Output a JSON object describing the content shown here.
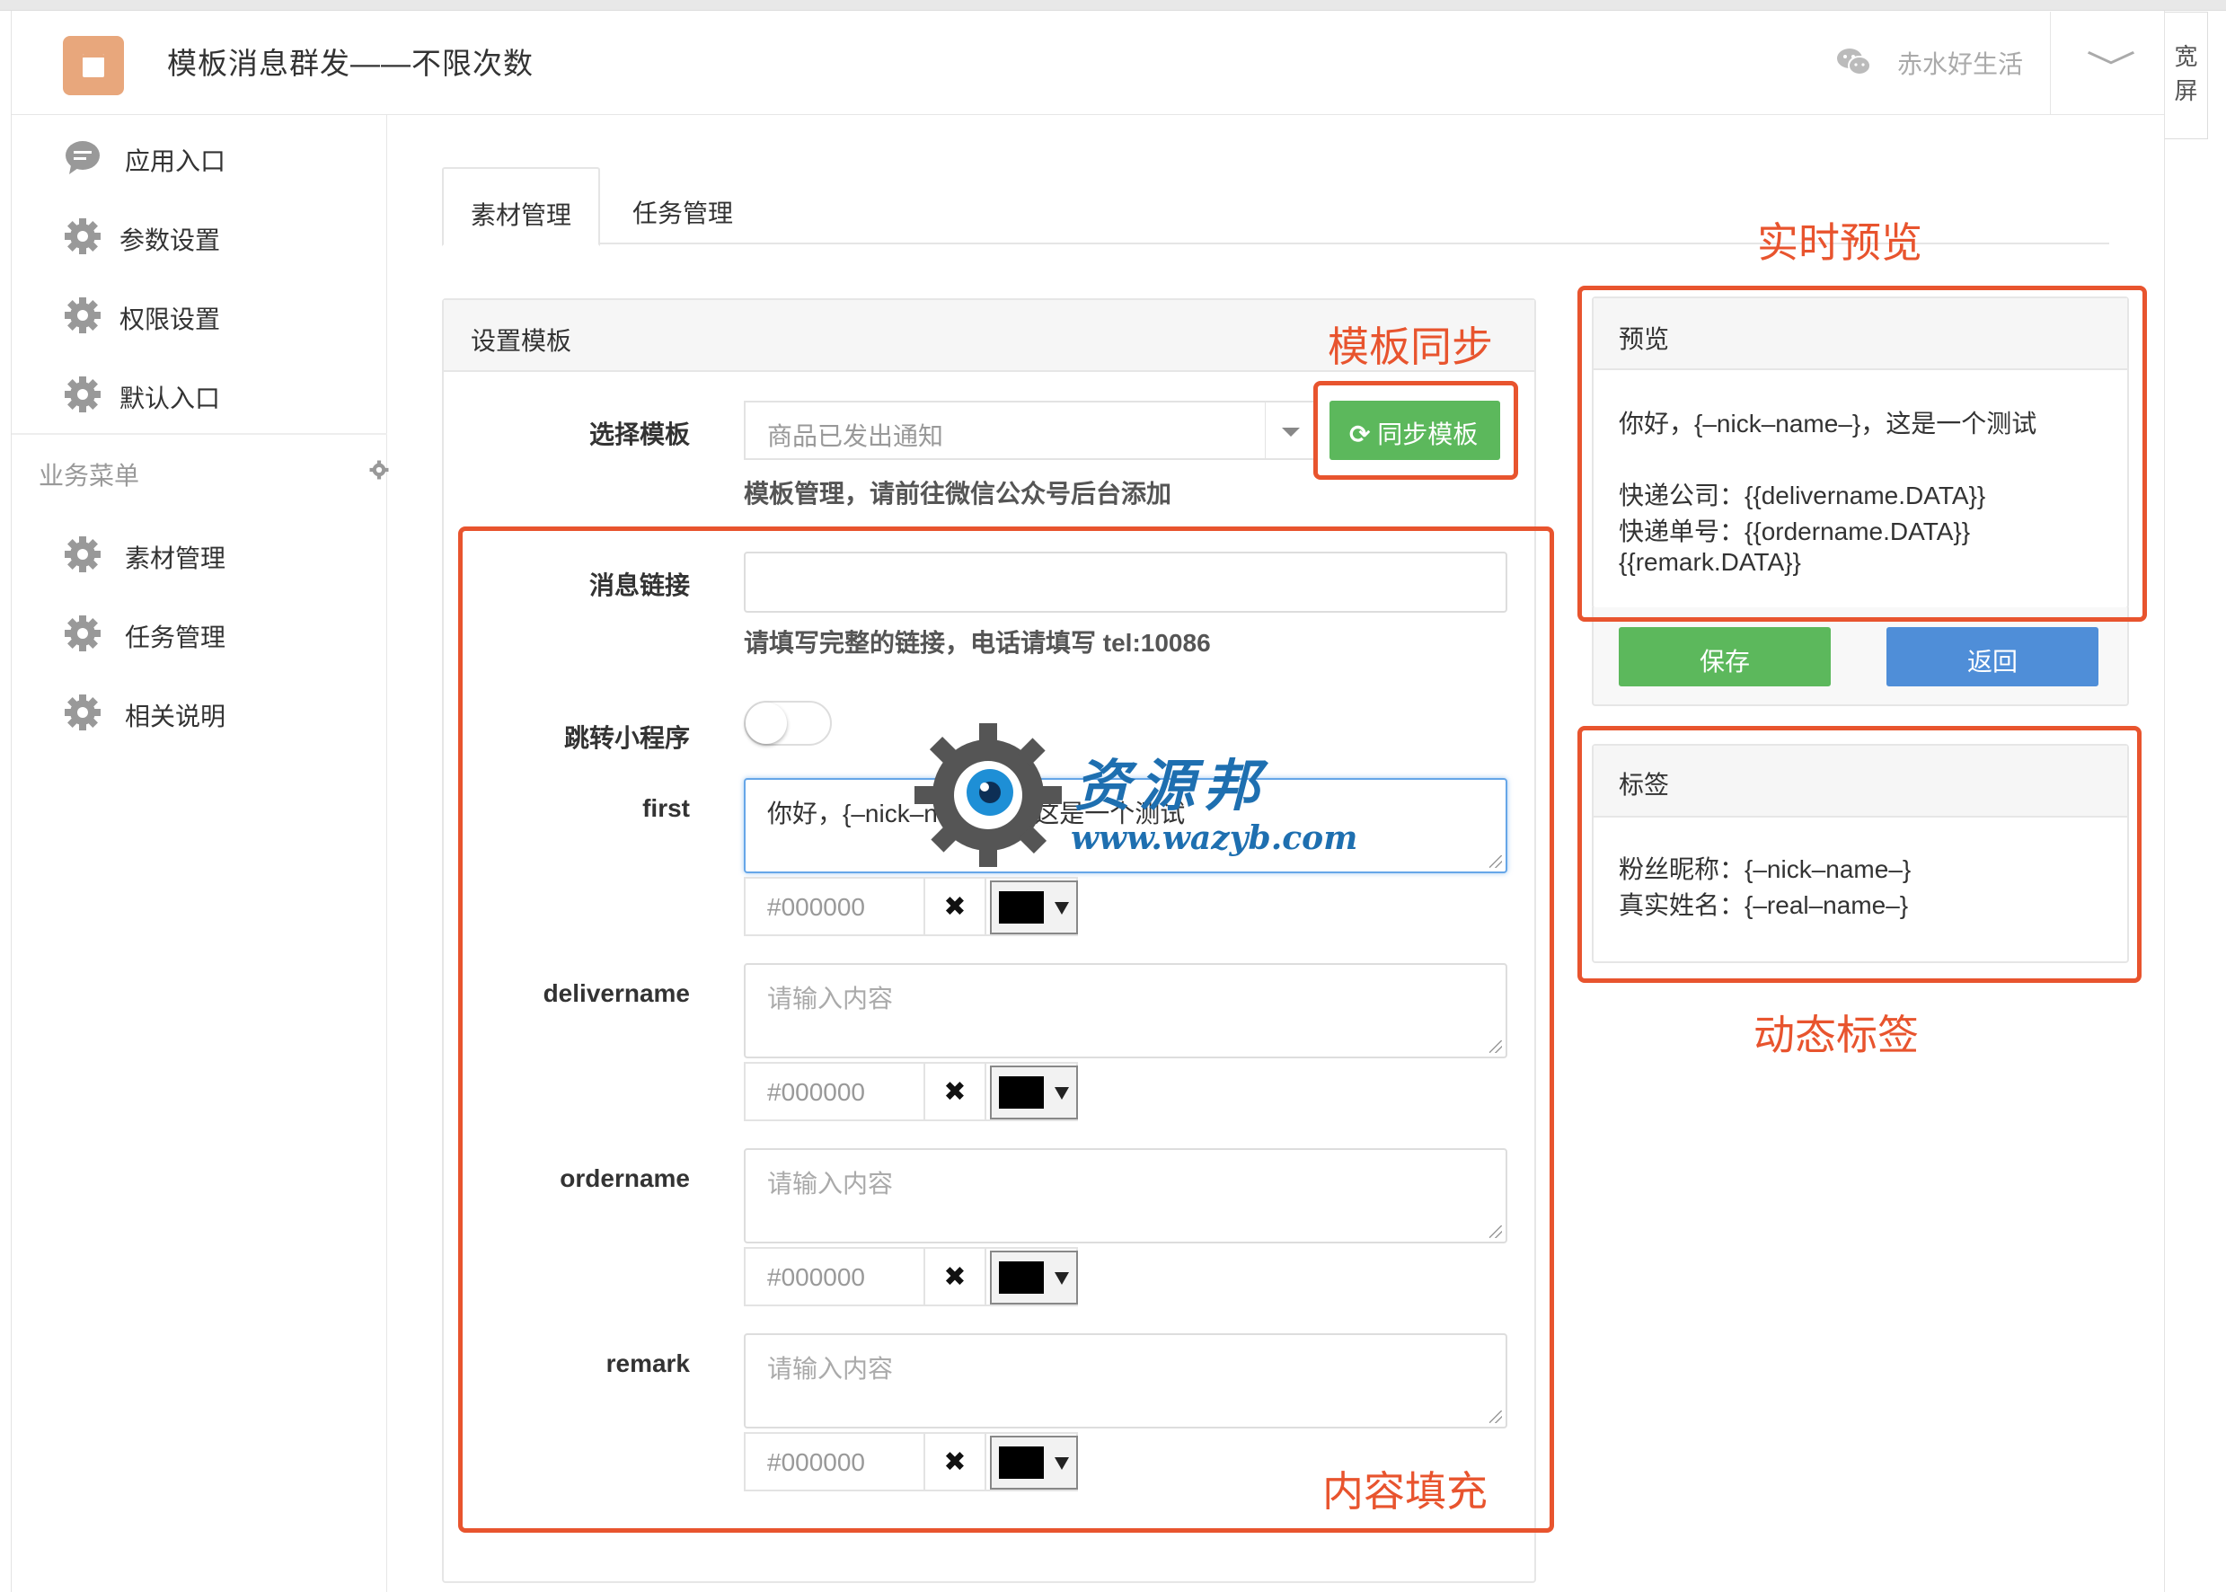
{
  "header": {
    "title": "模板消息群发——不限次数",
    "account": "赤水好生活",
    "wide_label": "宽屏"
  },
  "sidebar": {
    "items": [
      {
        "label": "应用入口",
        "icon": "chat-icon"
      },
      {
        "label": "参数设置",
        "icon": "gear-icon"
      },
      {
        "label": "权限设置",
        "icon": "gear-icon"
      },
      {
        "label": "默认入口",
        "icon": "gear-icon"
      }
    ],
    "section_title": "业务菜单",
    "biz_items": [
      {
        "label": "素材管理",
        "icon": "gear-icon"
      },
      {
        "label": "任务管理",
        "icon": "gear-icon"
      },
      {
        "label": "相关说明",
        "icon": "gear-icon"
      }
    ]
  },
  "tabs": [
    "素材管理",
    "任务管理"
  ],
  "form": {
    "panel_title": "设置模板",
    "select_label": "选择模板",
    "select_value": "商品已发出通知",
    "sync_button": "同步模板",
    "select_help": "模板管理，请前往微信公众号后台添加",
    "link_label": "消息链接",
    "link_value": "",
    "link_help": "请填写完整的链接，电话请填写 tel:10086",
    "miniprogram_label": "跳转小程序",
    "fields": [
      {
        "label": "first",
        "value": "你好，{–nick–name–}，这是一个测试",
        "placeholder": "请输入内容",
        "color": "#000000"
      },
      {
        "label": "delivername",
        "value": "",
        "placeholder": "请输入内容",
        "color": "#000000"
      },
      {
        "label": "ordername",
        "value": "",
        "placeholder": "请输入内容",
        "color": "#000000"
      },
      {
        "label": "remark",
        "value": "",
        "placeholder": "请输入内容",
        "color": "#000000"
      }
    ],
    "clear_symbol": "✖"
  },
  "preview": {
    "title": "预览",
    "line1": "你好，{–nick–name–}，这是一个测试",
    "line2": "快递公司：{{delivername.DATA}}",
    "line3": "快递单号：{{ordername.DATA}}",
    "line4": "{{remark.DATA}}",
    "save": "保存",
    "back": "返回"
  },
  "tags": {
    "title": "标签",
    "line1": "粉丝昵称：{–nick–name–}",
    "line2": "真实姓名：{–real–name–}"
  },
  "annotations": {
    "sync": "模板同步",
    "preview": "实时预览",
    "content": "内容填充",
    "tags": "动态标签",
    "color": "#e8542e"
  },
  "watermark": {
    "title": "资源邦",
    "url": "www.wazyb.com"
  }
}
